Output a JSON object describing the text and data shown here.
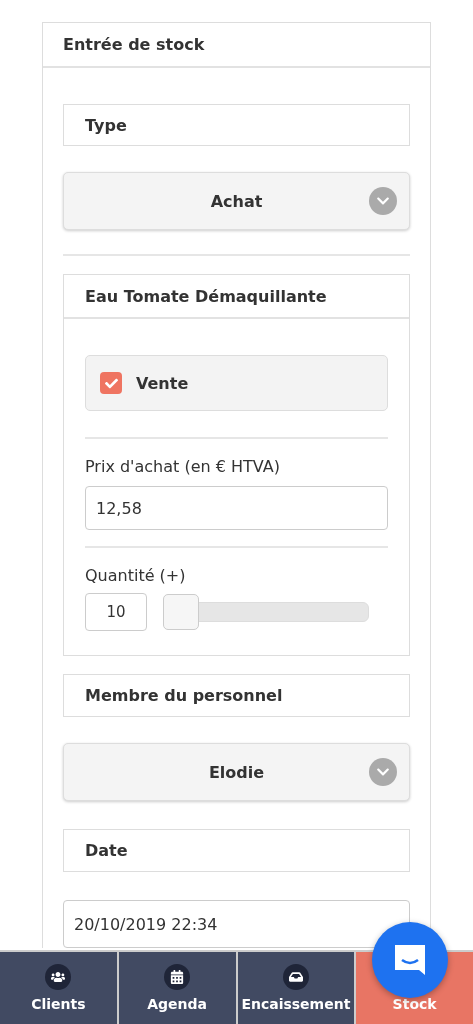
{
  "panel": {
    "title": "Entrée de stock"
  },
  "type": {
    "label": "Type",
    "value": "Achat"
  },
  "product": {
    "title": "Eau Tomate Démaquillante",
    "sale": {
      "label": "Vente",
      "checked": true
    },
    "price": {
      "label": "Prix d'achat (en € HTVA)",
      "value": "12,58"
    },
    "quantity": {
      "label": "Quantité (+)",
      "value": "10",
      "level": 0
    }
  },
  "staff": {
    "label": "Membre du personnel",
    "value": "Elodie"
  },
  "date": {
    "label": "Date",
    "value": "20/10/2019 22:34"
  },
  "nav": [
    {
      "label": "Clients",
      "selected": false
    },
    {
      "label": "Agenda",
      "selected": false
    },
    {
      "label": "Encaissement",
      "selected": false
    },
    {
      "label": "Stock",
      "selected": true
    }
  ]
}
